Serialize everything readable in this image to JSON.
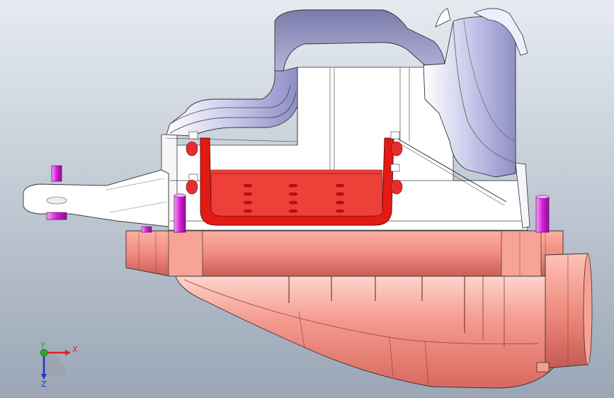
{
  "viewport": {
    "background_top": "#e6ebf1",
    "background_bottom": "#9aa6b6"
  },
  "model": {
    "housing_color": "#f08c80",
    "housing_shade": "#c95f58",
    "upper_body_color": "#ffffff",
    "upper_body_shade": "#a8a8d8",
    "bracket_color": "#e41a14",
    "bolt_color": "#d21fd8",
    "fastener_color": "#e62e2e"
  },
  "triad": {
    "x_label": "X",
    "y_label": "Y",
    "z_label": "Z",
    "x_color": "#e02020",
    "y_color": "#20b020",
    "z_color": "#2030d0"
  }
}
